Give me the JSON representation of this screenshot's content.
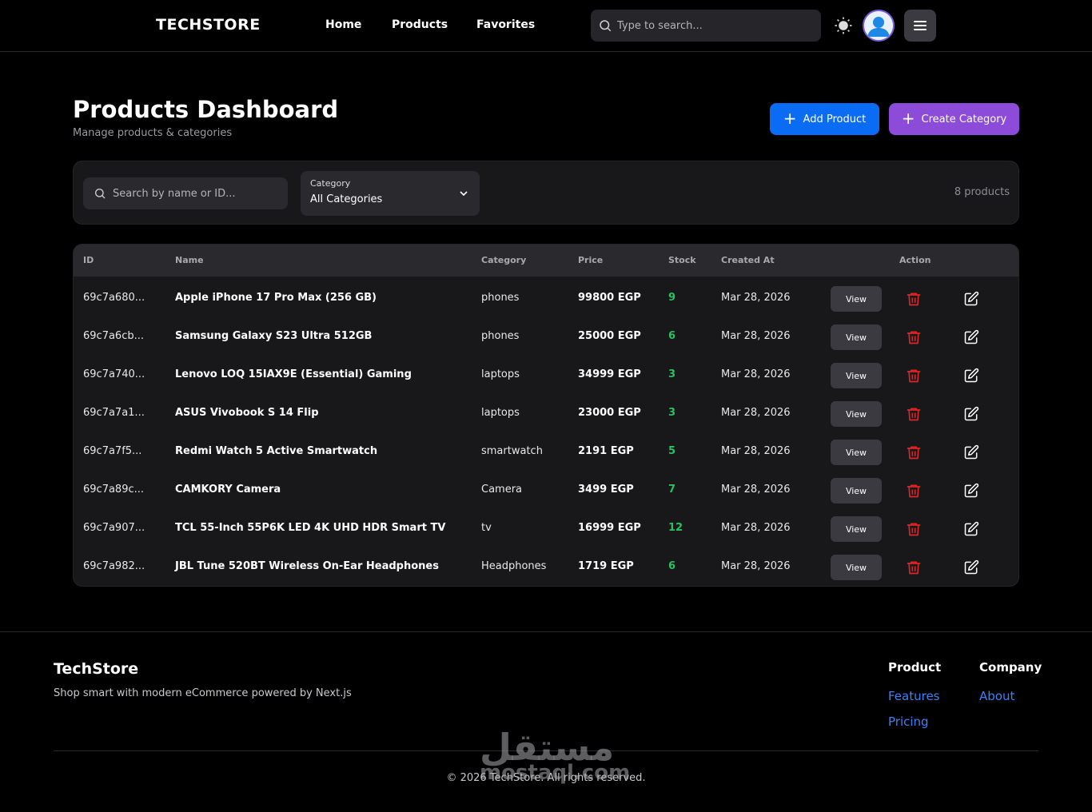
{
  "nav": {
    "logo": "TECHSTORE",
    "links": [
      "Home",
      "Products",
      "Favorites"
    ],
    "search_placeholder": "Type to search..."
  },
  "header": {
    "title": "Products Dashboard",
    "subtitle": "Manage products & categories",
    "add_product_label": "Add Product",
    "create_category_label": "Create Category"
  },
  "filters": {
    "search_placeholder": "Search by name or ID...",
    "category_caption": "Category",
    "category_value": "All Categories",
    "count_text": "8 products"
  },
  "table": {
    "columns": [
      "ID",
      "Name",
      "Category",
      "Price",
      "Stock",
      "Created At",
      "Action"
    ],
    "view_label": "View",
    "rows": [
      {
        "id": "69c7a680...",
        "name": "Apple iPhone 17 Pro Max (256 GB)",
        "category": "phones",
        "price": "99800 EGP",
        "stock": "9",
        "created": "Mar 28, 2026"
      },
      {
        "id": "69c7a6cb...",
        "name": "Samsung Galaxy S23 Ultra 512GB",
        "category": "phones",
        "price": "25000 EGP",
        "stock": "6",
        "created": "Mar 28, 2026"
      },
      {
        "id": "69c7a740...",
        "name": "Lenovo LOQ 15IAX9E (Essential) Gaming",
        "category": "laptops",
        "price": "34999 EGP",
        "stock": "3",
        "created": "Mar 28, 2026"
      },
      {
        "id": "69c7a7a1...",
        "name": "ASUS Vivobook S 14 Flip",
        "category": "laptops",
        "price": "23000 EGP",
        "stock": "3",
        "created": "Mar 28, 2026"
      },
      {
        "id": "69c7a7f5...",
        "name": "Redmi Watch 5 Active Smartwatch",
        "category": "smartwatch",
        "price": "2191 EGP",
        "stock": "5",
        "created": "Mar 28, 2026"
      },
      {
        "id": "69c7a89c...",
        "name": "CAMKORY Camera",
        "category": "Camera",
        "price": "3499 EGP",
        "stock": "7",
        "created": "Mar 28, 2026"
      },
      {
        "id": "69c7a907...",
        "name": "TCL 55-Inch 55P6K LED 4K UHD HDR Smart TV",
        "category": "tv",
        "price": "16999 EGP",
        "stock": "12",
        "created": "Mar 28, 2026"
      },
      {
        "id": "69c7a982...",
        "name": "JBL Tune 520BT Wireless On-Ear Headphones",
        "category": "Headphones",
        "price": "1719 EGP",
        "stock": "6",
        "created": "Mar 28, 2026"
      }
    ]
  },
  "footer": {
    "brand": "TechStore",
    "tagline": "Shop smart with modern eCommerce powered by Next.js",
    "product_title": "Product",
    "product_links": [
      "Features",
      "Pricing"
    ],
    "company_title": "Company",
    "company_links": [
      "About"
    ],
    "copyright": "© 2026 TechStore. All rights reserved."
  },
  "watermark": {
    "arabic": "مستقل",
    "latin": "mostaql.com"
  },
  "colors": {
    "primary": "#0a6cf5",
    "secondary": "#8c4bd8",
    "stock": "#22c55e",
    "danger": "#dc2626",
    "link": "#3b82f6"
  },
  "icons": {
    "search": "search-icon",
    "theme": "sun-icon",
    "menu": "hamburger-icon",
    "chevron": "chevron-down-icon",
    "delete": "trash-icon",
    "edit": "edit-icon"
  }
}
